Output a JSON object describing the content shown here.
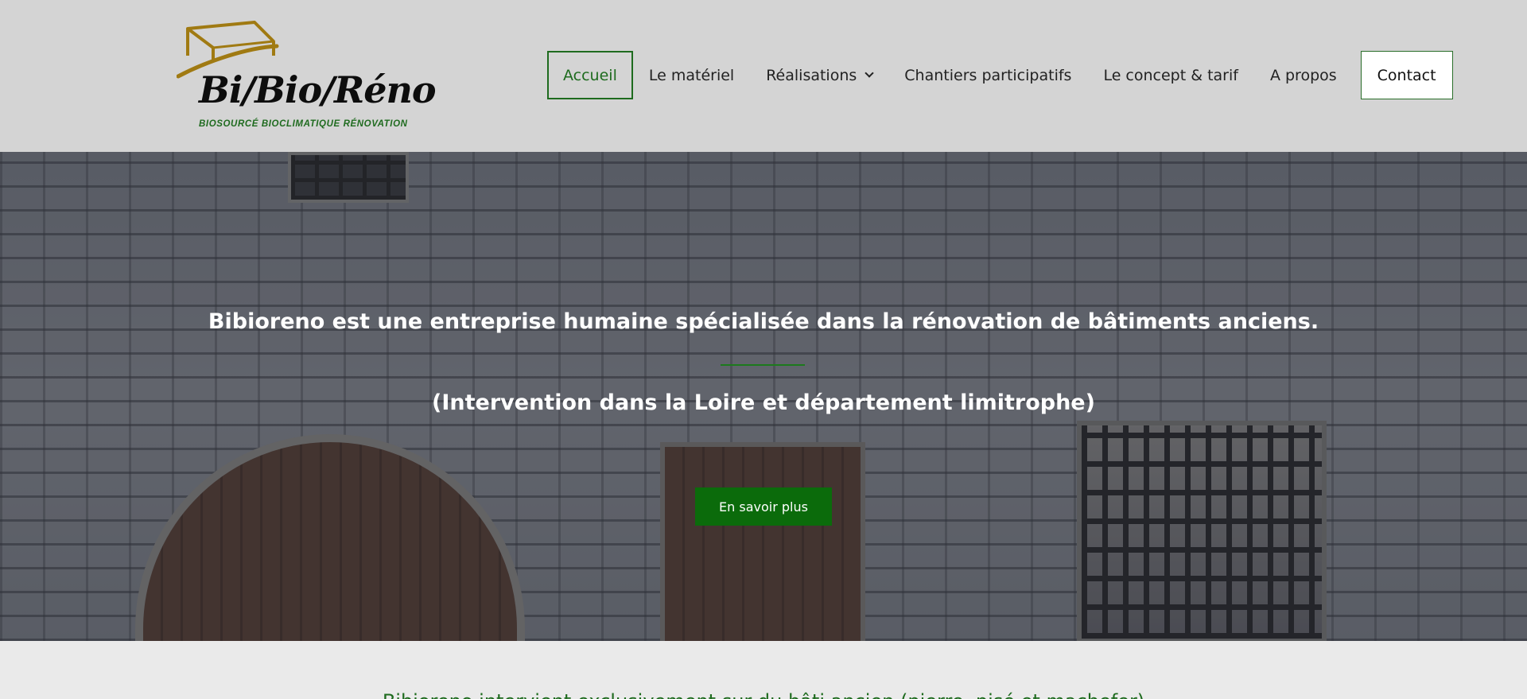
{
  "brand": {
    "logo_text": "Bi/Bio/Réno",
    "tagline": "BIOSOURCÉ   BIOCLIMATIQUE   RÉNOVATION",
    "colors": {
      "gold": "#a07a12",
      "green": "#1e6b1e"
    }
  },
  "nav": {
    "items": [
      {
        "label": "Accueil",
        "active": true
      },
      {
        "label": "Le matériel"
      },
      {
        "label": "Réalisations",
        "has_dropdown": true
      },
      {
        "label": "Chantiers participatifs"
      },
      {
        "label": "Le concept & tarif"
      },
      {
        "label": "A propos"
      }
    ],
    "contact_label": "Contact"
  },
  "hero": {
    "title": "Bibioreno est une entreprise humaine spécialisée dans la rénovation de bâtiments anciens.",
    "subtitle": "(Intervention dans la Loire et département limitrophe)",
    "button_label": "En savoir plus",
    "button_color": "#0b6b0b"
  },
  "intro": {
    "text": "Bibioreno intervient exclusivement sur du bâti ancien (pierre, pisé et machefer)"
  }
}
